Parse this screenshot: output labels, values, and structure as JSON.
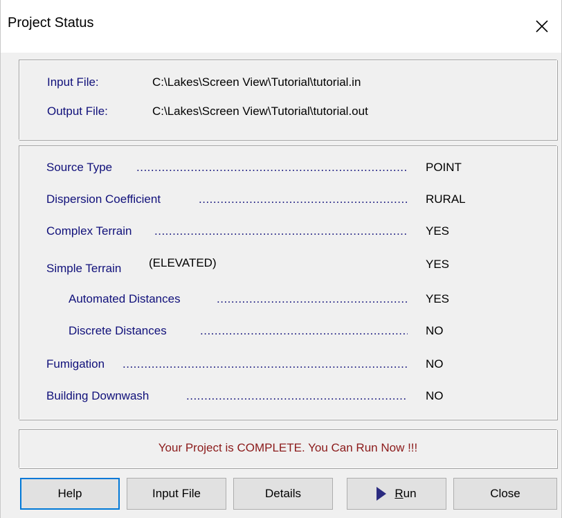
{
  "window": {
    "title": "Project Status"
  },
  "files": {
    "input_label": "Input File:",
    "input_value": "C:\\Lakes\\Screen View\\Tutorial\\tutorial.in",
    "output_label": "Output File:",
    "output_value": "C:\\Lakes\\Screen View\\Tutorial\\tutorial.out"
  },
  "settings": [
    {
      "label": "Source Type",
      "value": "POINT"
    },
    {
      "label": "Dispersion Coefficient",
      "value": "RURAL"
    },
    {
      "label": "Complex Terrain",
      "value": "YES"
    },
    {
      "label": "Simple Terrain",
      "value": "YES",
      "note": "(ELEVATED)"
    },
    {
      "label": "Automated Distances",
      "value": "YES"
    },
    {
      "label": "Discrete Distances",
      "value": "NO"
    },
    {
      "label": "Fumigation",
      "value": "NO"
    },
    {
      "label": "Building Downwash",
      "value": "NO"
    }
  ],
  "status": {
    "message": "Your Project is COMPLETE.  You Can Run Now !!!"
  },
  "buttons": {
    "help": "Help",
    "input_file": "Input File",
    "details": "Details",
    "run": "Run",
    "close": "Close"
  },
  "icons": {
    "close": "close-icon",
    "run": "play-arrow-icon"
  },
  "colors": {
    "label_blue": "#10107a",
    "status_red": "#8b1a1a",
    "dialog_bg": "#f0f0f0",
    "focus_border": "#0078d7"
  }
}
